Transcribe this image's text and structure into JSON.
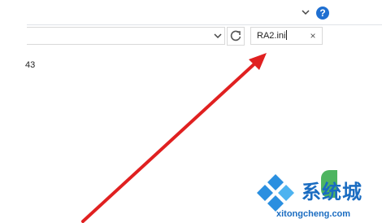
{
  "toolbar": {
    "help_label": "?"
  },
  "address": {
    "value": ""
  },
  "search": {
    "value": "RA2.ini",
    "clear_label": "×"
  },
  "content": {
    "partial_text": "43"
  },
  "watermark": {
    "brand_cn": "系统城",
    "url": "xitongcheng.com"
  },
  "colors": {
    "accent": "#1f6fd1",
    "arrow": "#e02020",
    "watermark": "#1a6cc1"
  }
}
